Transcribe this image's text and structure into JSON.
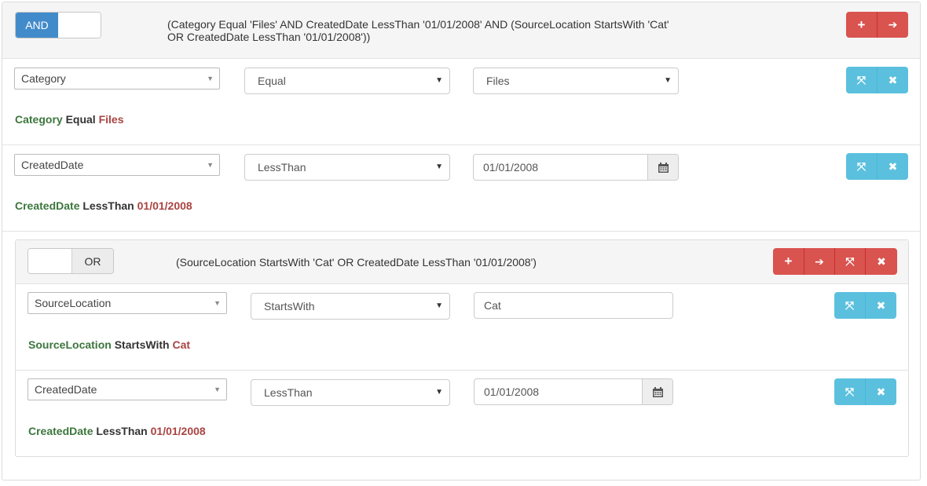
{
  "root_group": {
    "toggle": {
      "active": "AND",
      "inactive": ""
    },
    "expression": "(Category Equal 'Files' AND CreatedDate LessThan '01/01/2008' AND (SourceLocation StartsWith 'Cat' OR CreatedDate LessThan '01/01/2008'))",
    "expression_line1": "(Category Equal 'Files' AND CreatedDate LessThan '01/01/2008' AND (SourceLocation StartsWith 'Cat'",
    "expression_line2": "OR CreatedDate LessThan '01/01/2008'))",
    "rules": [
      {
        "field": "Category",
        "operator": "Equal",
        "value": "Files",
        "value_kind": "dropdown",
        "summary": {
          "field": "Category",
          "operator": "Equal",
          "value": "Files"
        }
      },
      {
        "field": "CreatedDate",
        "operator": "LessThan",
        "value": "01/01/2008",
        "value_kind": "date",
        "summary": {
          "field": "CreatedDate",
          "operator": "LessThan",
          "value": "01/01/2008"
        }
      }
    ],
    "actions": [
      {
        "icon": "plus-icon",
        "glyph": "+"
      },
      {
        "icon": "share-icon",
        "glyph": "➔"
      }
    ]
  },
  "nested_group": {
    "toggle": {
      "active": "OR",
      "inactive": ""
    },
    "expression": "(SourceLocation StartsWith 'Cat' OR CreatedDate LessThan '01/01/2008')",
    "rules": [
      {
        "field": "SourceLocation",
        "operator": "StartsWith",
        "value": "Cat",
        "value_kind": "text",
        "summary": {
          "field": "SourceLocation",
          "operator": "StartsWith",
          "value": "Cat"
        }
      },
      {
        "field": "CreatedDate",
        "operator": "LessThan",
        "value": "01/01/2008",
        "value_kind": "date",
        "summary": {
          "field": "CreatedDate",
          "operator": "LessThan",
          "value": "01/01/2008"
        }
      }
    ]
  },
  "rule_actions": {
    "expand_glyph": "⤧",
    "delete_glyph": "✖"
  },
  "colors": {
    "danger": "#d9534f",
    "info": "#5bc0de",
    "primary": "#428bca",
    "field_text": "#3c763d",
    "value_text": "#a94442"
  }
}
